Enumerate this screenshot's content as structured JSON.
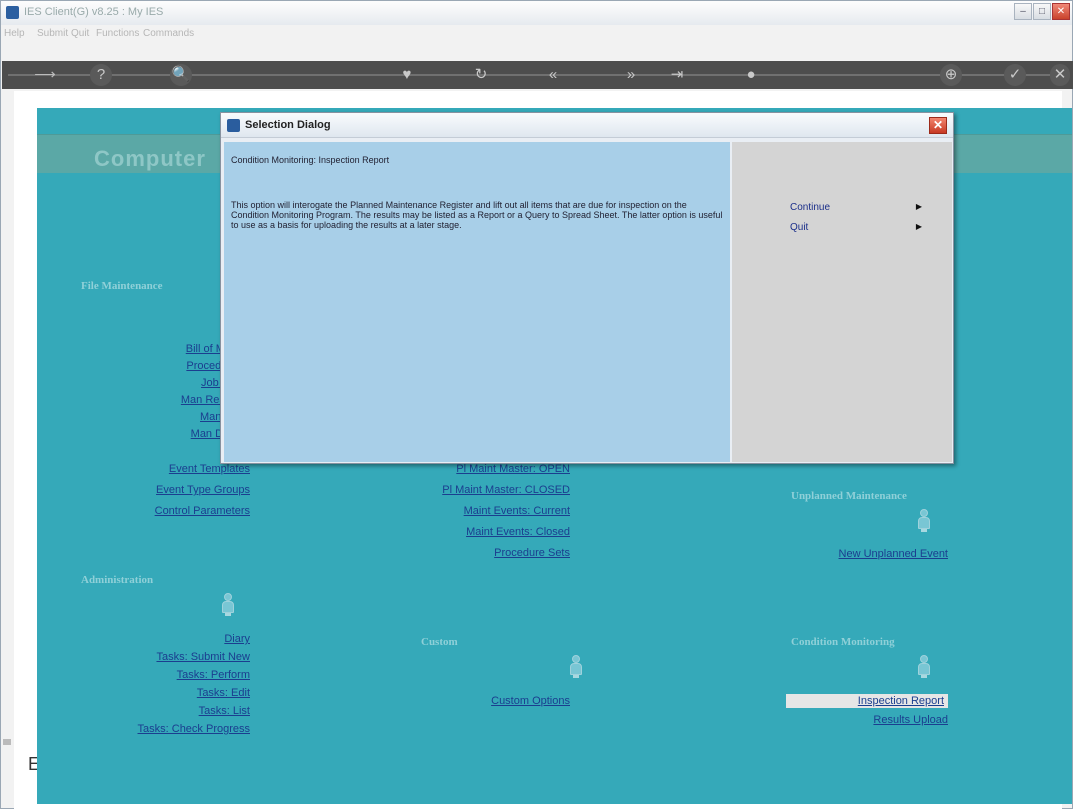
{
  "window": {
    "title": "IES Client(G) v8.25 : My IES",
    "minimize": "–",
    "maximize": "□",
    "close": "✕"
  },
  "menu": [
    "Help",
    "Submit",
    "Quit",
    "Functions",
    "Commands"
  ],
  "toolbar": {
    "items": [
      "⟶",
      "?",
      "🔍",
      "♥",
      "↻",
      "«",
      "»",
      "⇥",
      "●",
      "⊕",
      "✓",
      "✕"
    ]
  },
  "brand": "Computer",
  "sections": {
    "file_maintenance": "File Maintenance",
    "administration": "Administration",
    "custom": "Custom",
    "unplanned": "Unplanned Maintenance",
    "condition": "Condition Monitoring"
  },
  "file_links": [
    "Bill of Ma",
    "Procedur",
    "Job M",
    "Man Reso",
    "Man T",
    "Man Dis",
    "Event Templates",
    "Event Type Groups",
    "Control Parameters"
  ],
  "mid_links": [
    "Pl Maint Master: OPEN",
    "Pl Maint Master: CLOSED",
    "Maint Events: Current",
    "Maint Events: Closed",
    "Procedure Sets"
  ],
  "unplanned_links": [
    "New Unplanned Event"
  ],
  "admin_links": [
    "Diary",
    "Tasks: Submit New",
    "Tasks: Perform",
    "Tasks: Edit",
    "Tasks: List",
    "Tasks: Check Progress"
  ],
  "custom_links": [
    "Custom Options"
  ],
  "condition_links": [
    "Inspection Report",
    "Results Upload"
  ],
  "dialog": {
    "title": "Selection Dialog",
    "header": "Condition Monitoring: Inspection Report",
    "description": "This option will interogate the Planned Maintenance Register and lift out all items that are due for inspection on the Condition Monitoring Program. The results may be listed as a Report or a Query to Spread Sheet. The latter option is useful to use as a basis for uploading the results at a later stage.",
    "options": [
      {
        "label": "Continue",
        "arrow": "▶"
      },
      {
        "label": "Quit",
        "arrow": "▶"
      }
    ],
    "close": "✕"
  },
  "fragment": "E"
}
